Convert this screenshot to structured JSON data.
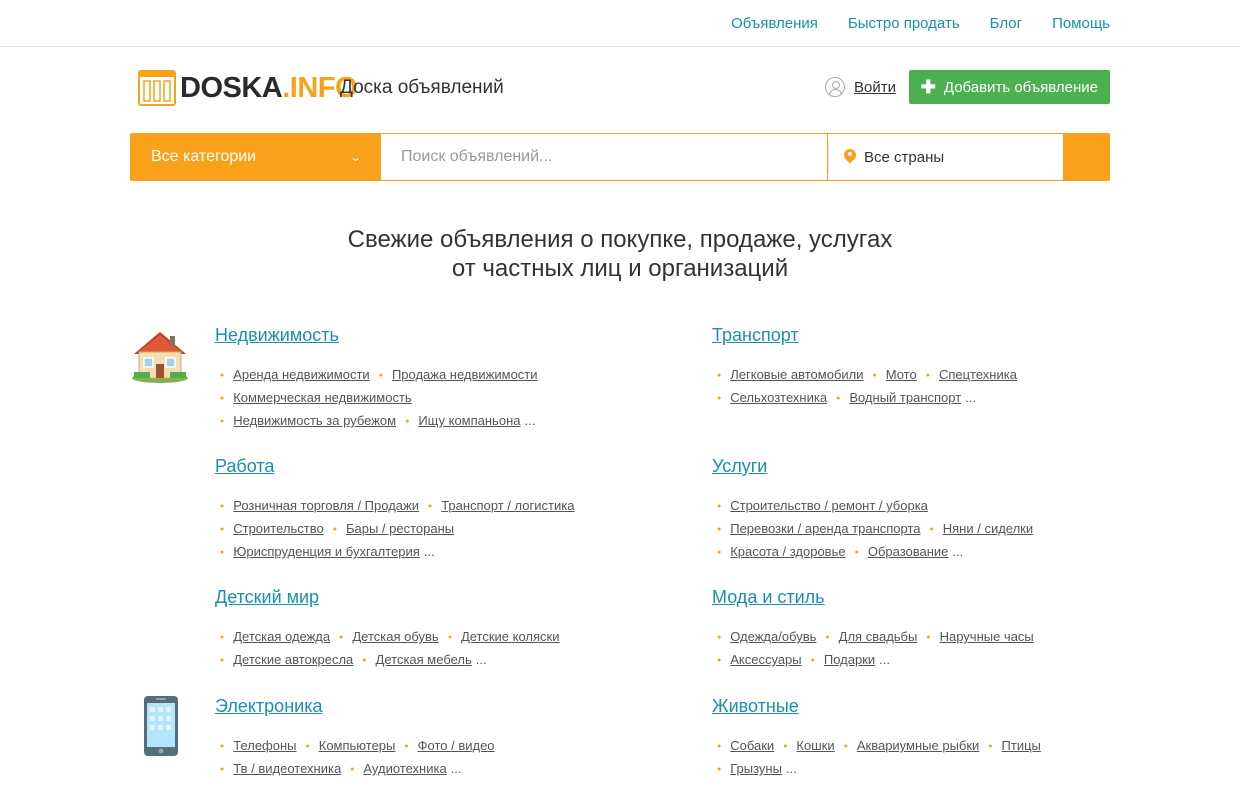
{
  "topnav": [
    "Объявления",
    "Быстро продать",
    "Блог",
    "Помощь"
  ],
  "logo": {
    "main": "DOSKA",
    "dot": ".",
    "info": "INFO"
  },
  "tagline": "Доска объявлений",
  "login": "Войти",
  "add_button": "Добавить объявление",
  "search": {
    "category": "Все категории",
    "placeholder": "Поиск объявлений...",
    "country": "Все страны"
  },
  "headline": {
    "line1": "Свежие объявления о покупке, продаже, услугах",
    "line2": "от частных лиц и организаций"
  },
  "colors": {
    "accent": "#f9a11b",
    "link": "#1a8fb0",
    "add": "#4caf50"
  },
  "categories": [
    {
      "title": "Недвижимость",
      "icon": "house-icon",
      "rows": [
        [
          "Аренда недвижимости",
          "Продажа недвижимости"
        ],
        [
          "Коммерческая недвижимость"
        ],
        [
          "Недвижимость за рубежом",
          "Ищу компаньона"
        ]
      ],
      "more": "..."
    },
    {
      "title": "Транспорт",
      "rows": [
        [
          "Легковые автомобили",
          "Мото",
          "Спецтехника"
        ],
        [
          "Сельхозтехника",
          "Водный транспорт"
        ]
      ],
      "more": "..."
    },
    {
      "title": "Работа",
      "rows": [
        [
          "Розничная торговля / Продажи",
          "Транспорт / логистика"
        ],
        [
          "Строительство",
          "Бары / рестораны"
        ],
        [
          "Юриспруденция и бухгалтерия"
        ]
      ],
      "more": "..."
    },
    {
      "title": "Услуги",
      "rows": [
        [
          "Строительство / ремонт / уборка"
        ],
        [
          "Перевозки / аренда транспорта",
          "Няни / сиделки"
        ],
        [
          "Красота / здоровье",
          "Образование"
        ]
      ],
      "more": "..."
    },
    {
      "title": "Детский мир",
      "rows": [
        [
          "Детская одежда",
          "Детская обувь",
          "Детские коляски"
        ],
        [
          "Детские автокресла",
          "Детская мебель"
        ]
      ],
      "more": "..."
    },
    {
      "title": "Мода и стиль",
      "rows": [
        [
          "Одежда/обувь",
          "Для свадьбы",
          "Наручные часы"
        ],
        [
          "Аксессуары",
          "Подарки"
        ]
      ],
      "more": "..."
    },
    {
      "title": "Электроника",
      "icon": "phone-icon",
      "rows": [
        [
          "Телефоны",
          "Компьютеры",
          "Фото / видео"
        ],
        [
          "Тв / видеотехника",
          "Аудиотехника"
        ]
      ],
      "more": "..."
    },
    {
      "title": "Животные",
      "rows": [
        [
          "Собаки",
          "Кошки",
          "Аквариумные рыбки",
          "Птицы"
        ],
        [
          "Грызуны"
        ]
      ],
      "more": "..."
    }
  ]
}
